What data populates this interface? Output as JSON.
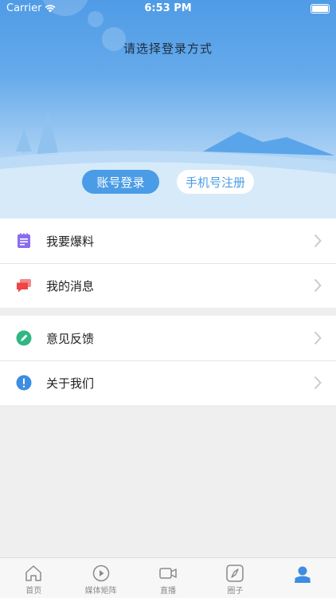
{
  "status_bar": {
    "carrier": "Carrier",
    "time": "6:53 PM"
  },
  "header": {
    "title": "请选择登录方式",
    "account_login": "账号登录",
    "phone_register": "手机号注册"
  },
  "menu": {
    "group1": [
      {
        "label": "我要爆料",
        "icon": "notepad-icon",
        "color": "#8b6cf0"
      },
      {
        "label": "我的消息",
        "icon": "message-icon",
        "color": "#ee4545"
      }
    ],
    "group2": [
      {
        "label": "意见反馈",
        "icon": "pencil-icon",
        "color": "#2fb785"
      },
      {
        "label": "关于我们",
        "icon": "info-icon",
        "color": "#3d8de0"
      }
    ]
  },
  "tabbar": {
    "items": [
      {
        "label": "首页",
        "icon": "home-icon",
        "active": false
      },
      {
        "label": "媒体矩阵",
        "icon": "play-icon",
        "active": false
      },
      {
        "label": "直播",
        "icon": "video-camera-icon",
        "active": false
      },
      {
        "label": "圈子",
        "icon": "compass-icon",
        "active": false
      },
      {
        "label": "",
        "icon": "profile-icon",
        "active": true
      }
    ]
  },
  "colors": {
    "accent": "#4a9ce6",
    "active_tab": "#3d8de0"
  }
}
